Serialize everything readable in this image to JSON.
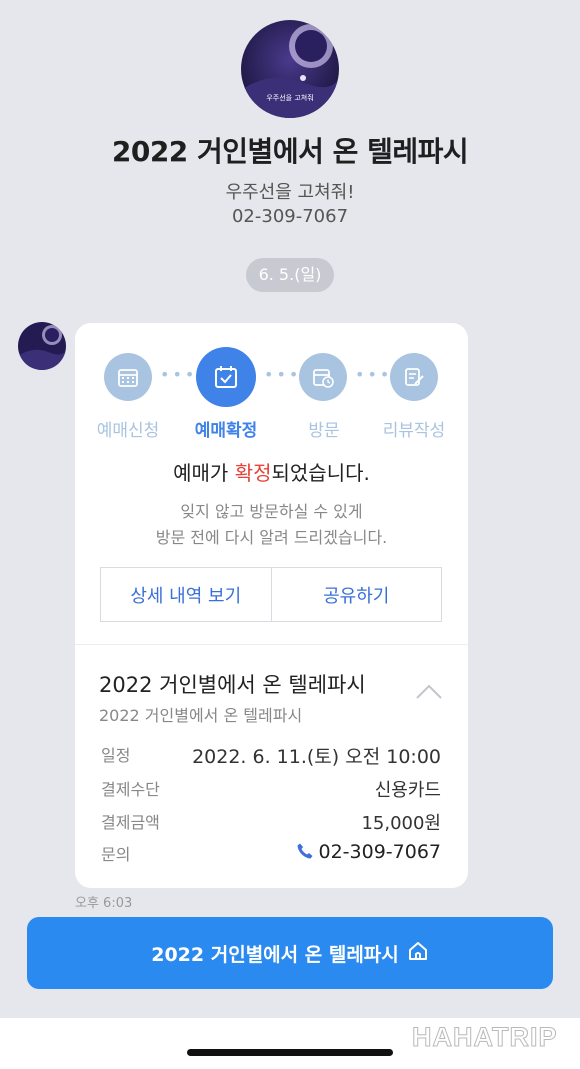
{
  "header": {
    "title": "2022 거인별에서 온 텔레파시",
    "subtitle": "우주선을 고쳐줘!",
    "phone": "02-309-7067",
    "poster_text": "우주선을 고쳐줘"
  },
  "chat": {
    "date": "6. 5.(일)",
    "timestamp": "오후 6:03"
  },
  "steps": [
    {
      "label": "예매신청",
      "icon": "calendar-grid-icon"
    },
    {
      "label": "예매확정",
      "icon": "calendar-check-icon"
    },
    {
      "label": "방문",
      "icon": "calendar-clock-icon"
    },
    {
      "label": "리뷰작성",
      "icon": "document-pencil-icon"
    }
  ],
  "confirmation": {
    "before": "예매가 ",
    "highlight": "확정",
    "after": "되었습니다.",
    "line1": "잊지 않고 방문하실 수 있게",
    "line2": "방문 전에 다시 알려 드리겠습니다."
  },
  "buttons": {
    "details": "상세 내역 보기",
    "share": "공유하기"
  },
  "booking": {
    "show_name": "2022 거인별에서 온 텔레파시",
    "show_sub": "2022 거인별에서 온 텔레파시",
    "rows": [
      {
        "label": "일정",
        "value": "2022. 6. 11.(토) 오전 10:00"
      },
      {
        "label": "결제수단",
        "value": "신용카드"
      },
      {
        "label": "결제금액",
        "value": "15,000원"
      },
      {
        "label": "문의",
        "value": "02-309-7067"
      }
    ]
  },
  "cta": {
    "label": "2022 거인별에서 온 텔레파시",
    "icon": "home-icon"
  },
  "watermark": "HAHATRIP",
  "colors": {
    "accent": "#3f82e8",
    "inactive_step": "#a9c4e0",
    "highlight": "#e8423a",
    "cta": "#2b8af0",
    "background": "#e6e7ec"
  }
}
